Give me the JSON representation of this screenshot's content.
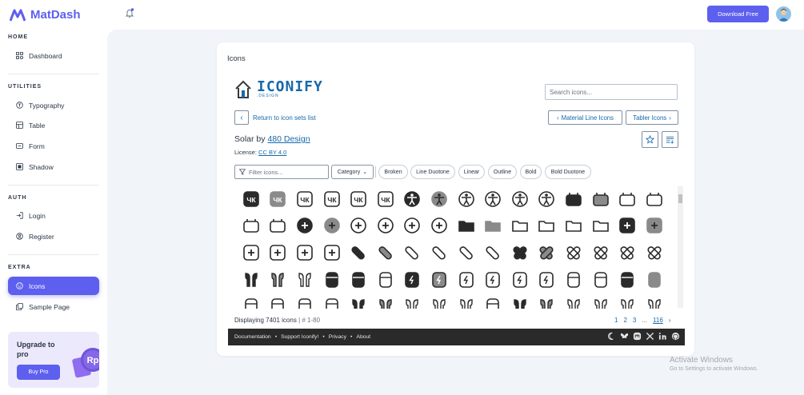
{
  "app": {
    "name": "MatDash"
  },
  "sidebar": {
    "sections": [
      {
        "caption": "HOME"
      },
      {
        "caption": "UTILITIES"
      },
      {
        "caption": "AUTH"
      },
      {
        "caption": "EXTRA"
      }
    ],
    "items": [
      {
        "label": "Dashboard",
        "icon": "dashboard-icon"
      },
      {
        "label": "Typography",
        "icon": "typography-icon"
      },
      {
        "label": "Table",
        "icon": "table-icon"
      },
      {
        "label": "Form",
        "icon": "form-icon"
      },
      {
        "label": "Shadow",
        "icon": "shadow-icon"
      },
      {
        "label": "Login",
        "icon": "login-icon"
      },
      {
        "label": "Register",
        "icon": "register-icon"
      },
      {
        "label": "Icons",
        "icon": "icons-icon",
        "active": true
      },
      {
        "label": "Sample Page",
        "icon": "sample-page-icon"
      }
    ],
    "promo": {
      "title": "Upgrade to pro",
      "button": "Buy Pro",
      "badge": "Rp"
    }
  },
  "topbar": {
    "download_button": "Download Free"
  },
  "card": {
    "title": "Icons",
    "iconify": {
      "word": "ICONIFY",
      "sub": ".DESIGN"
    },
    "search_placeholder": "Search icons...",
    "return_link": "Return to icon sets list",
    "prev_set": "Material Line Icons",
    "next_set": "Tabler Icons",
    "set_name_prefix": "Solar by",
    "set_author": "480 Design",
    "license_label": "License:",
    "license_value": "CC BY 4.0",
    "filter_placeholder": "Filter icons...",
    "category_label": "Category",
    "chips": [
      "Broken",
      "Line Duotone",
      "Linear",
      "Outline",
      "Bold",
      "Bold Duotone"
    ],
    "displaying": "Displaying 7401 icons",
    "range": "# 1-80",
    "pages": [
      "1",
      "2",
      "3",
      "...",
      "116"
    ],
    "footer_links": [
      "Documentation",
      "Support Iconify!",
      "Privacy",
      "About"
    ]
  },
  "watermark": {
    "title": "Activate Windows",
    "subtitle": "Go to Settings to activate Windows."
  },
  "colors": {
    "accent": "#5d5fef",
    "link": "#1769aa",
    "bg": "#f1f4f9"
  }
}
